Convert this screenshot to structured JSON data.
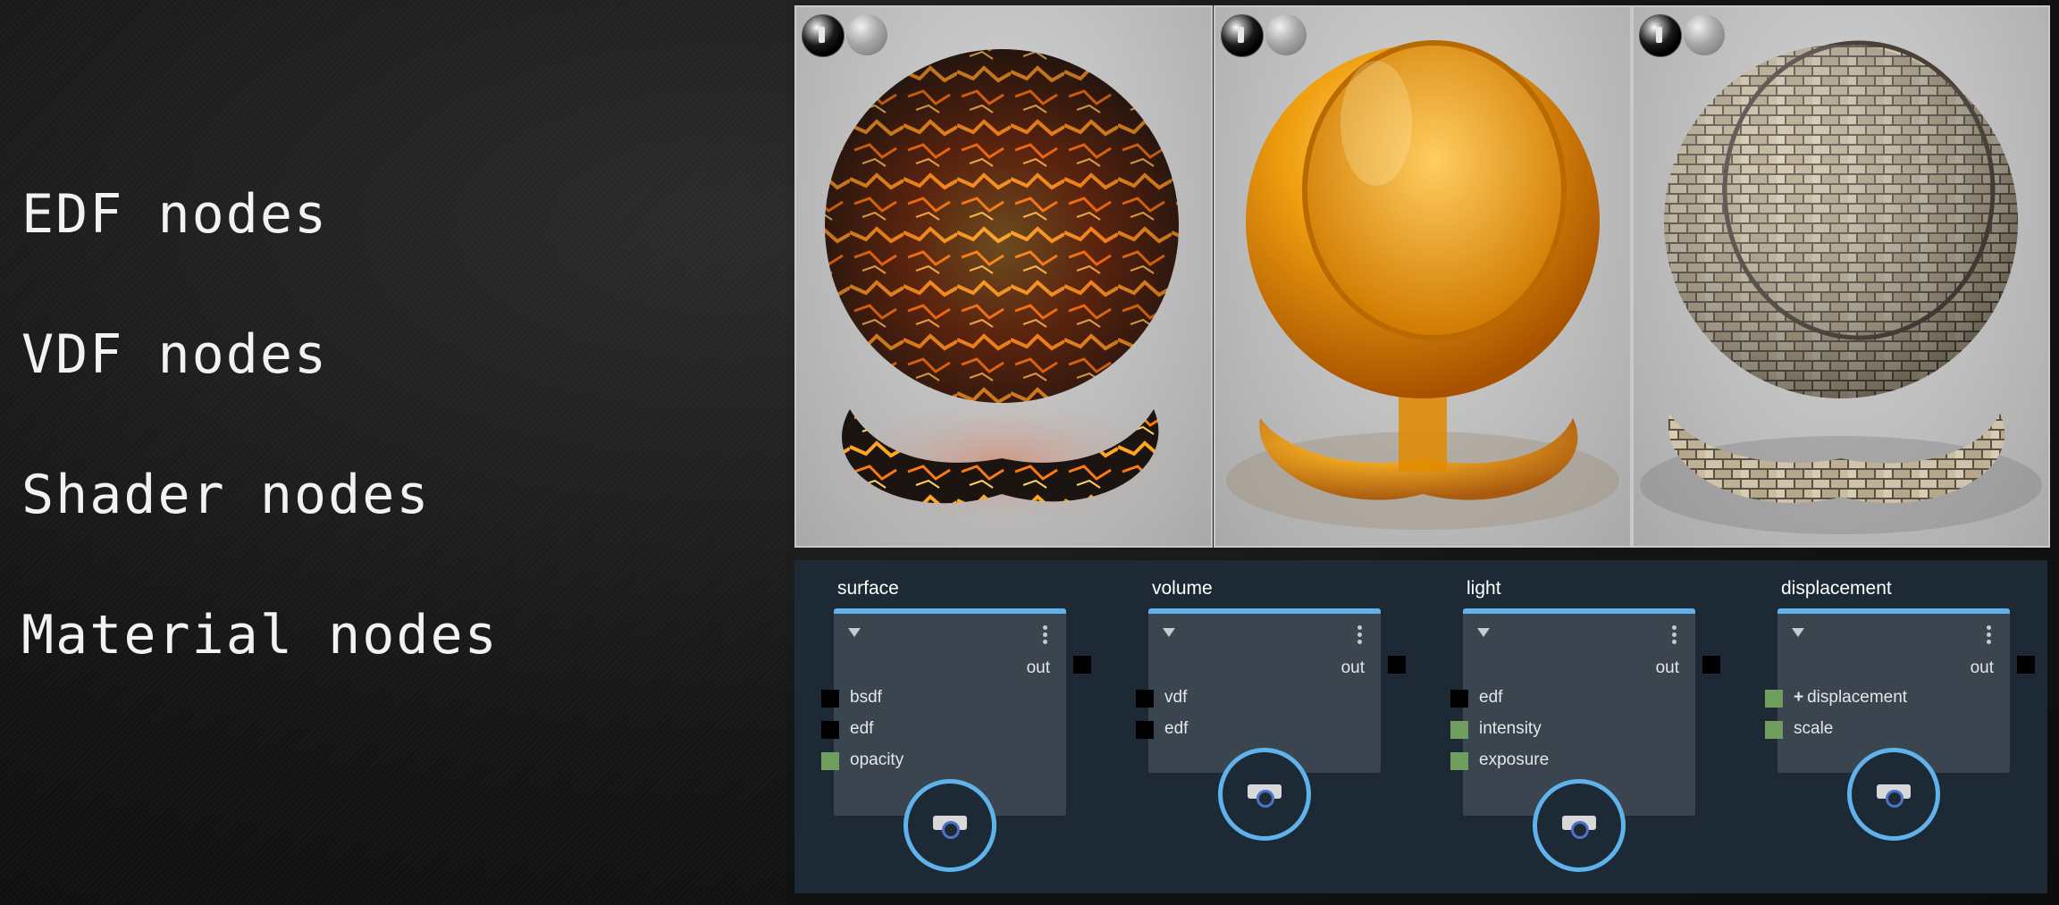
{
  "headings": [
    "EDF nodes",
    "VDF nodes",
    "Shader nodes",
    "Material nodes"
  ],
  "previews": [
    {
      "name": "lava-material",
      "accent": "#ff7a10"
    },
    {
      "name": "amber-glass-material",
      "accent": "#e08a00"
    },
    {
      "name": "brick-material",
      "accent": "#b7aa92"
    }
  ],
  "nodes": [
    {
      "title": "surface",
      "out": "out",
      "inputs": [
        {
          "label": "bsdf",
          "port": "black"
        },
        {
          "label": "edf",
          "port": "black"
        },
        {
          "label": "opacity",
          "port": "green"
        }
      ]
    },
    {
      "title": "volume",
      "out": "out",
      "inputs": [
        {
          "label": "vdf",
          "port": "black"
        },
        {
          "label": "edf",
          "port": "black"
        }
      ]
    },
    {
      "title": "light",
      "out": "out",
      "inputs": [
        {
          "label": "edf",
          "port": "black"
        },
        {
          "label": "intensity",
          "port": "green"
        },
        {
          "label": "exposure",
          "port": "green"
        }
      ]
    },
    {
      "title": "displacement",
      "out": "out",
      "inputs": [
        {
          "label": "displacement",
          "port": "green",
          "prefix": "+"
        },
        {
          "label": "scale",
          "port": "green"
        }
      ]
    }
  ],
  "colors": {
    "editor_bg": "#1d2a36",
    "node_body": "#3a4550",
    "node_accent": "#5fb3ea",
    "port_black": "#000000",
    "port_green": "#6f9e5e"
  },
  "icons": {
    "collapse": "triangle-down-icon",
    "menu": "vertical-dots-icon",
    "preview": "camera-icon"
  }
}
